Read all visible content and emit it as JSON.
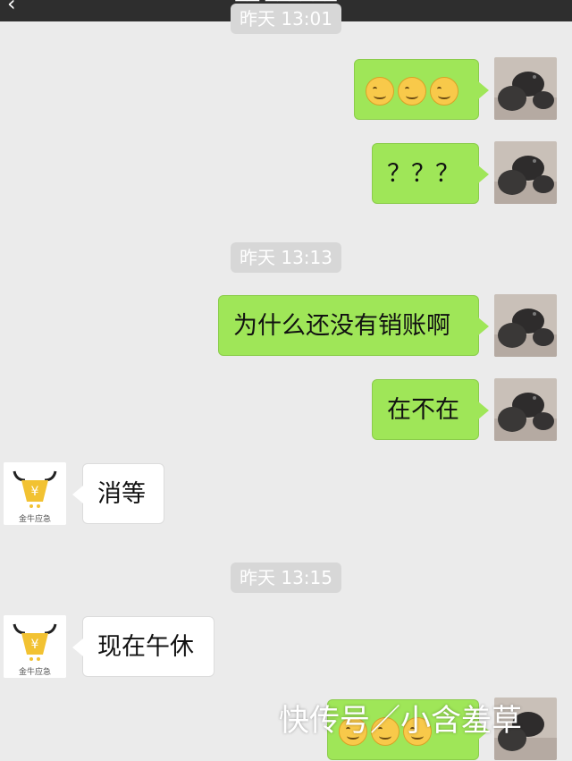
{
  "timestamps": [
    "昨天 13:01",
    "昨天 13:13",
    "昨天 13:15"
  ],
  "messages": {
    "emojis": "😊😊😊",
    "questions": "？？？",
    "why": "为什么还没有销账啊",
    "here": "在不在",
    "reply1": "消等",
    "reply2": "现在午休"
  },
  "other_avatar_caption": "金牛应急",
  "watermark": "快传号／小含羞草",
  "colors": {
    "outgoing": "#9fe658",
    "incoming": "#ffffff",
    "background": "#ebebeb"
  }
}
